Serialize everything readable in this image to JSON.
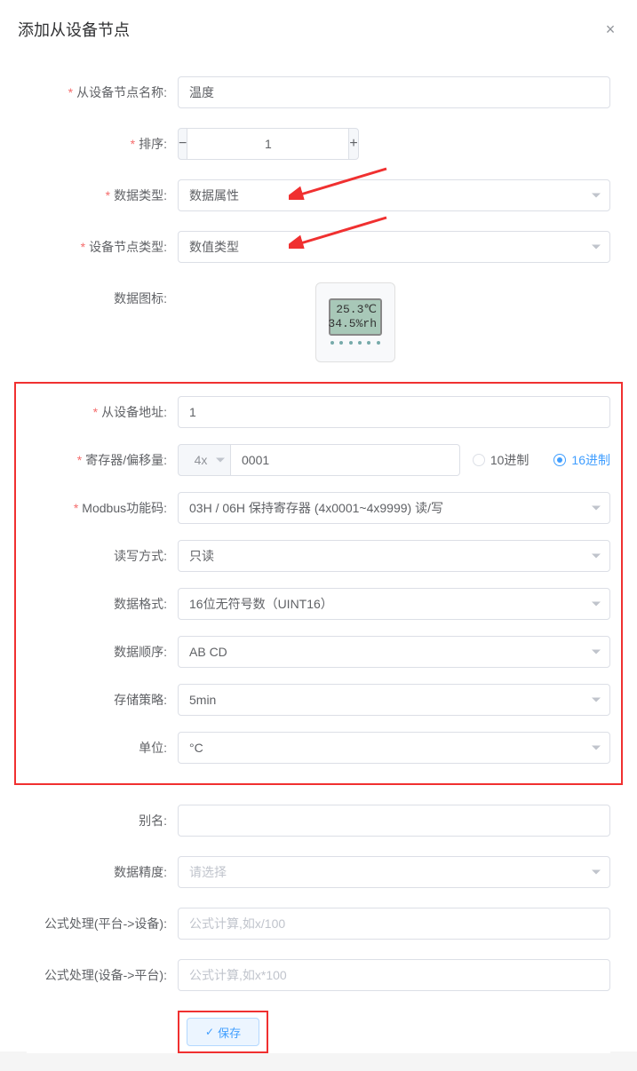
{
  "modal": {
    "title": "添加从设备节点"
  },
  "form": {
    "node_name": {
      "label": "从设备节点名称:",
      "value": "温度"
    },
    "sort": {
      "label": "排序:",
      "value": "1"
    },
    "data_type": {
      "label": "数据类型:",
      "value": "数据属性"
    },
    "node_type": {
      "label": "设备节点类型:",
      "value": "数值类型"
    },
    "data_icon": {
      "label": "数据图标:",
      "lcd_line1": "25.3℃",
      "lcd_line2": "34.5%rh"
    },
    "slave_address": {
      "label": "从设备地址:",
      "value": "1"
    },
    "register": {
      "label": "寄存器/偏移量:",
      "prefix": "4x",
      "value": "0001",
      "radix_dec": "10进制",
      "radix_hex": "16进制"
    },
    "modbus_func": {
      "label": "Modbus功能码:",
      "value": "03H / 06H 保持寄存器 (4x0001~4x9999) 读/写"
    },
    "rw_mode": {
      "label": "读写方式:",
      "value": "只读"
    },
    "data_format": {
      "label": "数据格式:",
      "value": "16位无符号数（UINT16）"
    },
    "byte_order": {
      "label": "数据顺序:",
      "value": "AB CD"
    },
    "storage": {
      "label": "存储策略:",
      "value": "5min"
    },
    "unit": {
      "label": "单位:",
      "value": "°C"
    },
    "alias": {
      "label": "别名:",
      "value": ""
    },
    "precision": {
      "label": "数据精度:",
      "placeholder": "请选择"
    },
    "formula_p2d": {
      "label": "公式处理(平台->设备):",
      "placeholder": "公式计算,如x/100"
    },
    "formula_d2p": {
      "label": "公式处理(设备->平台):",
      "placeholder": "公式计算,如x*100"
    }
  },
  "buttons": {
    "save": "保存"
  }
}
